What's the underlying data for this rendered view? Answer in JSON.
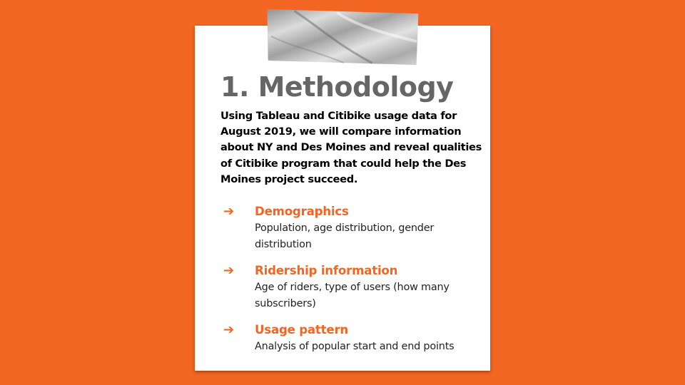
{
  "slide": {
    "title": "1. Methodology",
    "intro": "Using Tableau and Citibike usage data for August 2019, we will compare information about NY and Des Moines and reveal qualities of Citibike program that could help the Des Moines project succeed.",
    "items": [
      {
        "title": "Demographics",
        "description": "Population, age distribution, gender distribution"
      },
      {
        "title": "Ridership information",
        "description": "Age of riders, type of users (how many subscribers)"
      },
      {
        "title": "Usage pattern",
        "description": "Analysis of popular start and end points"
      }
    ]
  },
  "icons": {
    "bullet": "right-arrow-icon",
    "tape": "tape-icon"
  },
  "colors": {
    "background": "#f26522",
    "accent": "#f26522",
    "title": "#666666",
    "card": "#ffffff"
  }
}
